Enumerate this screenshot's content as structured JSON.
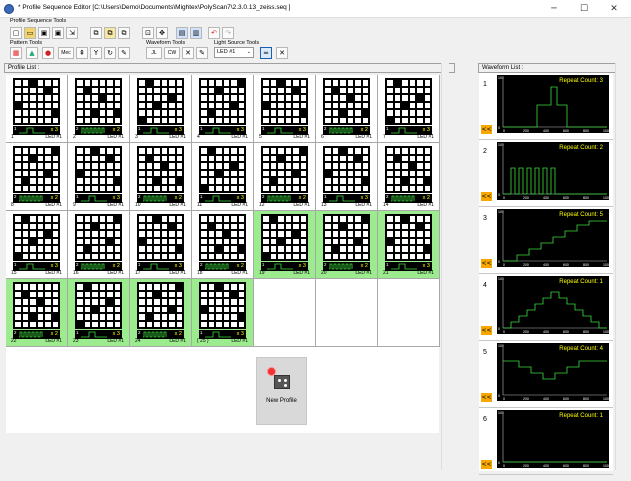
{
  "window": {
    "title": "* Profile Sequence Editor [C:\\Users\\Demo\\Documents\\Mightex\\PolyScan7\\2.3.0.13_zeiss.seq ]",
    "minimize": "─",
    "maximize": "☐",
    "close": "✕"
  },
  "toolbar": {
    "profile_sequence_tools": "Profile Sequence Tools",
    "pattern_tools": "Pattern Tools",
    "waveform_tools": "Waveform Tools",
    "light_source_tools": "Light Source Tools",
    "light_source_value": "LED #1",
    "mec_label": "Mec",
    "cw_label": "CW",
    "pulse_label": "JL"
  },
  "profile_list": {
    "header": "Profile List :",
    "new_profile_label": "New Profile",
    "cards": [
      {
        "num": "1",
        "led": "LED #1",
        "wn": "1",
        "rep": "x 3",
        "wave": "step",
        "green": false,
        "cells": [
          1,
          1,
          1,
          1,
          1,
          1,
          1,
          1,
          1,
          1,
          1,
          1,
          1,
          1,
          1,
          1,
          1,
          1,
          1,
          1,
          1,
          1,
          1,
          1,
          1,
          1,
          1,
          1,
          1,
          1,
          1,
          1,
          1,
          1,
          1,
          1
        ]
      },
      {
        "num": "2",
        "led": "LED #1",
        "wn": "2",
        "rep": "x 2",
        "wave": "pulse",
        "green": false,
        "cells": [
          1,
          1,
          1,
          1,
          1,
          1,
          1,
          1,
          1,
          1,
          1,
          1,
          1,
          1,
          1,
          1,
          1,
          1,
          1,
          1,
          1,
          1,
          1,
          1,
          1,
          1,
          1,
          1,
          1,
          1,
          1,
          1,
          1,
          1,
          1,
          1
        ]
      },
      {
        "num": "3",
        "led": "LED #1",
        "wn": "1",
        "rep": "x 3",
        "wave": "step",
        "green": false,
        "cells": [
          1,
          1,
          1,
          1,
          1,
          1,
          1,
          1,
          1,
          1,
          1,
          1,
          1,
          1,
          1,
          1,
          1,
          1,
          1,
          1,
          1,
          1,
          1,
          1,
          1,
          1,
          1,
          1,
          1,
          1,
          1,
          1,
          1,
          1,
          1,
          1
        ]
      },
      {
        "num": "4",
        "led": "LED #1",
        "wn": "1",
        "rep": "x 3",
        "wave": "step",
        "green": false,
        "cells": [
          1,
          1,
          1,
          1,
          1,
          1,
          1,
          1,
          1,
          1,
          1,
          1,
          1,
          1,
          1,
          1,
          1,
          1,
          1,
          1,
          1,
          1,
          1,
          1,
          1,
          1,
          1,
          1,
          1,
          1,
          1,
          1,
          1,
          1,
          1,
          1
        ]
      },
      {
        "num": "5",
        "led": "LED #1",
        "wn": "1",
        "rep": "x 3",
        "wave": "step",
        "green": false,
        "cells": [
          1,
          1,
          1,
          1,
          1,
          1,
          1,
          1,
          1,
          1,
          1,
          1,
          1,
          1,
          1,
          1,
          1,
          1,
          1,
          1,
          1,
          1,
          1,
          1,
          1,
          1,
          1,
          1,
          1,
          1,
          1,
          1,
          1,
          1,
          1,
          1
        ]
      },
      {
        "num": "6",
        "led": "LED #1",
        "wn": "2",
        "rep": "x 2",
        "wave": "pulse",
        "green": false,
        "cells": [
          1,
          1,
          1,
          1,
          1,
          1,
          1,
          1,
          1,
          1,
          1,
          1,
          1,
          1,
          1,
          1,
          1,
          1,
          1,
          1,
          1,
          1,
          1,
          1,
          1,
          1,
          1,
          1,
          1,
          1,
          1,
          1,
          1,
          1,
          1,
          1
        ]
      },
      {
        "num": "7",
        "led": "LED #1",
        "wn": "1",
        "rep": "x 3",
        "wave": "step",
        "green": false,
        "cells": [
          1,
          1,
          1,
          1,
          1,
          1,
          1,
          1,
          1,
          1,
          1,
          1,
          1,
          1,
          1,
          1,
          1,
          1,
          1,
          1,
          1,
          1,
          1,
          1,
          1,
          1,
          1,
          1,
          1,
          1,
          1,
          1,
          1,
          1,
          1,
          1
        ]
      },
      {
        "num": "8",
        "led": "LED #1",
        "wn": "2",
        "rep": "x 2",
        "wave": "pulse",
        "green": false,
        "cells": [
          1,
          1,
          1,
          1,
          1,
          1,
          1,
          1,
          1,
          1,
          1,
          1,
          1,
          1,
          1,
          1,
          1,
          1,
          1,
          1,
          1,
          1,
          1,
          1,
          1,
          1,
          1,
          1,
          1,
          1,
          1,
          1,
          1,
          1,
          1,
          1
        ]
      },
      {
        "num": "9",
        "led": "LED #1",
        "wn": "1",
        "rep": "x 3",
        "wave": "step",
        "green": false,
        "cells": [
          1,
          1,
          1,
          1,
          1,
          1,
          1,
          1,
          1,
          1,
          1,
          1,
          1,
          1,
          1,
          1,
          1,
          1,
          1,
          1,
          1,
          1,
          1,
          1,
          1,
          1,
          1,
          1,
          1,
          1,
          1,
          1,
          1,
          1,
          1,
          1
        ]
      },
      {
        "num": "10",
        "led": "LED #1",
        "wn": "2",
        "rep": "x 2",
        "wave": "pulse",
        "green": false,
        "cells": [
          1,
          1,
          1,
          1,
          1,
          1,
          1,
          1,
          1,
          1,
          1,
          1,
          1,
          1,
          1,
          1,
          1,
          1,
          1,
          1,
          1,
          1,
          1,
          1,
          1,
          1,
          1,
          1,
          1,
          1,
          1,
          1,
          1,
          1,
          1,
          1
        ]
      },
      {
        "num": "11",
        "led": "LED #1",
        "wn": "1",
        "rep": "x 3",
        "wave": "step",
        "green": false,
        "cells": [
          1,
          1,
          1,
          1,
          1,
          1,
          1,
          1,
          1,
          1,
          1,
          1,
          1,
          1,
          1,
          1,
          1,
          1,
          1,
          1,
          1,
          1,
          1,
          1,
          1,
          1,
          1,
          1,
          1,
          1,
          1,
          1,
          1,
          1,
          1,
          1
        ]
      },
      {
        "num": "12",
        "led": "LED #1",
        "wn": "2",
        "rep": "x 2",
        "wave": "pulse",
        "green": false,
        "cells": [
          1,
          1,
          1,
          1,
          1,
          1,
          1,
          1,
          1,
          1,
          1,
          1,
          1,
          1,
          1,
          1,
          1,
          1,
          1,
          1,
          1,
          1,
          1,
          1,
          1,
          1,
          1,
          1,
          1,
          1,
          1,
          1,
          1,
          1,
          1,
          1
        ]
      },
      {
        "num": "13",
        "led": "LED #1",
        "wn": "1",
        "rep": "x 3",
        "wave": "step",
        "green": false,
        "cells": [
          1,
          1,
          1,
          1,
          1,
          1,
          1,
          1,
          1,
          1,
          1,
          1,
          1,
          1,
          1,
          1,
          1,
          1,
          1,
          1,
          1,
          1,
          1,
          1,
          1,
          1,
          1,
          1,
          1,
          1,
          1,
          1,
          1,
          1,
          1,
          1
        ]
      },
      {
        "num": "14",
        "led": "LED #1",
        "wn": "2",
        "rep": "x 2",
        "wave": "pulse",
        "green": false,
        "cells": [
          1,
          1,
          1,
          1,
          1,
          1,
          1,
          1,
          1,
          1,
          1,
          1,
          1,
          1,
          1,
          1,
          1,
          1,
          1,
          1,
          1,
          1,
          1,
          1,
          1,
          1,
          1,
          1,
          1,
          1,
          1,
          1,
          1,
          1,
          1,
          1
        ]
      },
      {
        "num": "15",
        "led": "LED #1",
        "wn": "1",
        "rep": "x 3",
        "wave": "step",
        "green": false,
        "cells": [
          1,
          1,
          1,
          1,
          1,
          1,
          1,
          1,
          1,
          1,
          1,
          1,
          1,
          1,
          1,
          1,
          1,
          1,
          1,
          1,
          1,
          1,
          1,
          1,
          1,
          1,
          1,
          1,
          1,
          1,
          1,
          1,
          1,
          1,
          1,
          1
        ]
      },
      {
        "num": "16",
        "led": "LED #1",
        "wn": "2",
        "rep": "x 2",
        "wave": "pulse",
        "green": false,
        "cells": [
          1,
          1,
          1,
          1,
          1,
          1,
          1,
          1,
          1,
          1,
          1,
          1,
          1,
          1,
          1,
          1,
          1,
          1,
          1,
          1,
          1,
          1,
          1,
          1,
          1,
          1,
          1,
          1,
          1,
          1,
          1,
          1,
          1,
          1,
          1,
          1
        ]
      },
      {
        "num": "17",
        "led": "LED #1",
        "wn": "1",
        "rep": "x 3",
        "wave": "step",
        "green": false,
        "cells": [
          1,
          1,
          1,
          1,
          1,
          1,
          1,
          1,
          1,
          1,
          1,
          1,
          1,
          1,
          1,
          1,
          1,
          1,
          1,
          1,
          1,
          1,
          1,
          1,
          1,
          1,
          1,
          1,
          1,
          1,
          1,
          1,
          1,
          1,
          1,
          1
        ]
      },
      {
        "num": "18",
        "led": "LED #1",
        "wn": "2",
        "rep": "x 2",
        "wave": "pulse",
        "green": false,
        "cells": [
          1,
          1,
          1,
          1,
          1,
          1,
          1,
          1,
          1,
          1,
          1,
          1,
          1,
          1,
          1,
          1,
          1,
          1,
          1,
          1,
          1,
          1,
          1,
          1,
          1,
          1,
          1,
          1,
          1,
          1,
          1,
          1,
          1,
          1,
          1,
          1
        ]
      },
      {
        "num": "19",
        "led": "LED #1",
        "wn": "1",
        "rep": "x 3",
        "wave": "step",
        "green": true,
        "cells": [
          1,
          1,
          1,
          1,
          1,
          1,
          1,
          1,
          1,
          1,
          1,
          1,
          1,
          1,
          1,
          1,
          1,
          1,
          1,
          1,
          1,
          1,
          1,
          1,
          1,
          1,
          1,
          1,
          1,
          1,
          1,
          1,
          1,
          1,
          1,
          1
        ]
      },
      {
        "num": "20",
        "led": "LED #1",
        "wn": "2",
        "rep": "x 2",
        "wave": "pulse",
        "green": true,
        "cells": [
          1,
          1,
          1,
          1,
          1,
          1,
          1,
          1,
          1,
          1,
          1,
          1,
          1,
          1,
          1,
          1,
          1,
          1,
          1,
          1,
          1,
          1,
          1,
          1,
          1,
          1,
          1,
          1,
          1,
          1,
          1,
          1,
          1,
          1,
          1,
          1
        ]
      },
      {
        "num": "21",
        "led": "LED #1",
        "wn": "1",
        "rep": "x 3",
        "wave": "step",
        "green": true,
        "cells": [
          1,
          1,
          1,
          1,
          1,
          1,
          1,
          1,
          1,
          1,
          1,
          1,
          1,
          1,
          1,
          1,
          1,
          1,
          1,
          1,
          1,
          1,
          1,
          1,
          1,
          1,
          1,
          1,
          1,
          1,
          1,
          1,
          1,
          1,
          1,
          1
        ]
      },
      {
        "num": "22",
        "led": "LED #1",
        "wn": "2",
        "rep": "x 2",
        "wave": "pulse",
        "green": true,
        "cells": [
          1,
          1,
          1,
          1,
          1,
          1,
          1,
          1,
          1,
          1,
          1,
          1,
          1,
          1,
          1,
          1,
          1,
          1,
          1,
          1,
          1,
          1,
          1,
          1,
          1,
          1,
          1,
          1,
          1,
          1,
          1,
          1,
          1,
          1,
          1,
          1
        ]
      },
      {
        "num": "23",
        "led": "LED #1",
        "wn": "1",
        "rep": "x 3",
        "wave": "step",
        "green": true,
        "cells": [
          1,
          1,
          1,
          1,
          1,
          1,
          1,
          1,
          1,
          1,
          1,
          1,
          1,
          1,
          1,
          1,
          1,
          1,
          1,
          1,
          1,
          1,
          1,
          1,
          1,
          1,
          1,
          1,
          1,
          1,
          1,
          1,
          1,
          1,
          1,
          1
        ]
      },
      {
        "num": "24",
        "led": "LED #1",
        "wn": "2",
        "rep": "x 2",
        "wave": "pulse",
        "green": true,
        "cells": [
          1,
          1,
          1,
          1,
          1,
          1,
          1,
          1,
          1,
          1,
          1,
          1,
          1,
          1,
          1,
          1,
          1,
          1,
          1,
          1,
          1,
          1,
          1,
          1,
          1,
          1,
          1,
          1,
          1,
          1,
          1,
          1,
          1,
          1,
          1,
          1
        ]
      },
      {
        "num": "{ 25 }",
        "led": "LED #1",
        "wn": "1",
        "rep": "x 3",
        "wave": "step",
        "green": true,
        "cells": [
          1,
          1,
          1,
          1,
          1,
          1,
          1,
          1,
          1,
          1,
          1,
          1,
          1,
          1,
          1,
          1,
          1,
          1,
          1,
          1,
          1,
          1,
          1,
          1,
          1,
          1,
          1,
          1,
          1,
          1,
          1,
          1,
          1,
          1,
          1,
          1
        ]
      }
    ]
  },
  "waveform_list": {
    "header": "Waveform List :",
    "copy_button": "<<",
    "axis_y": [
      "100",
      "0"
    ],
    "axis_x": [
      "0",
      "200",
      "400",
      "600",
      "800",
      "1000"
    ],
    "items": [
      {
        "idx": "1",
        "repeat": "Repeat Count: 3",
        "shape": "step"
      },
      {
        "idx": "2",
        "repeat": "Repeat Count: 2",
        "shape": "pulse"
      },
      {
        "idx": "3",
        "repeat": "Repeat Count: 5",
        "shape": "stair"
      },
      {
        "idx": "4",
        "repeat": "Repeat Count: 1",
        "shape": "pyramid"
      },
      {
        "idx": "5",
        "repeat": "Repeat Count: 4",
        "shape": "valley"
      },
      {
        "idx": "6",
        "repeat": "Repeat Count: 1",
        "shape": "flat"
      }
    ]
  }
}
